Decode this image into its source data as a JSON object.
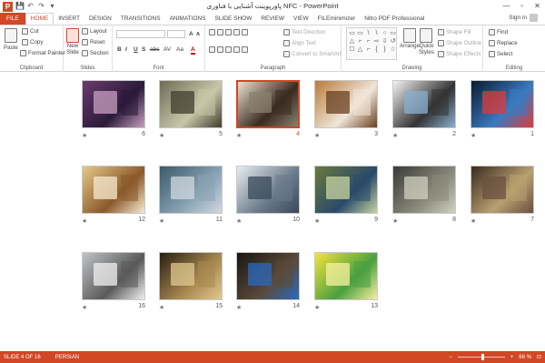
{
  "window": {
    "title": "پاورپوینت آشنایی با فناوری NFC - PowerPoint",
    "minimize": "—",
    "restore": "▫",
    "close": "✕"
  },
  "qat": {
    "app_icon": "P",
    "save": "💾",
    "undo": "↶",
    "redo": "↷",
    "customize": "▾"
  },
  "tabs": [
    "FILE",
    "HOME",
    "INSERT",
    "DESIGN",
    "TRANSITIONS",
    "ANIMATIONS",
    "SLIDE SHOW",
    "REVIEW",
    "VIEW",
    "FILEminimizer",
    "Nitro PDF Professional"
  ],
  "active_tab": "HOME",
  "signin": "Sign in",
  "ribbon": {
    "clipboard": {
      "paste": "Paste",
      "cut": "Cut",
      "copy": "Copy",
      "format_painter": "Format Painter",
      "label": "Clipboard"
    },
    "slides": {
      "new_slide": "New",
      "new_slide2": "Slide",
      "layout": "Layout",
      "reset": "Reset",
      "section": "Section",
      "label": "Slides"
    },
    "font": {
      "bold": "B",
      "italic": "I",
      "underline": "U",
      "shadow": "S",
      "strike": "abc",
      "spacing": "AV",
      "case": "Aa",
      "color": "A",
      "label": "Font"
    },
    "paragraph": {
      "text_direction": "Text Direction",
      "align_text": "Align Text",
      "convert": "Convert to SmartArt",
      "label": "Paragraph"
    },
    "drawing": {
      "arrange": "Arrange",
      "quick_styles": "Quick",
      "quick_styles2": "Styles",
      "shape_fill": "Shape Fill",
      "shape_outline": "Shape Outline",
      "shape_effects": "Shape Effects",
      "label": "Drawing",
      "shapes": [
        "▭",
        "▭",
        "\\",
        "\\",
        "○",
        "▭",
        "△",
        "⌐",
        "⌐",
        "⇨",
        "⇩",
        "↺",
        "☐",
        "△",
        "⌐",
        "{",
        "}",
        "☆"
      ]
    },
    "editing": {
      "find": "Find",
      "replace": "Replace",
      "select": "Select",
      "label": "Editing"
    }
  },
  "slides": [
    {
      "num": "6",
      "star": "★",
      "colors": [
        "#6b3a6e",
        "#2b1a3a",
        "#c8a0c0"
      ]
    },
    {
      "num": "5",
      "star": "★",
      "colors": [
        "#6f6b55",
        "#c9c6a8",
        "#403d2e"
      ]
    },
    {
      "num": "4",
      "star": "★",
      "colors": [
        "#e9e3d0",
        "#3a2b20",
        "#8a8070"
      ],
      "selected": true
    },
    {
      "num": "3",
      "star": "★",
      "colors": [
        "#b87a3a",
        "#f0e6d8",
        "#6a4020"
      ]
    },
    {
      "num": "2",
      "star": "★",
      "colors": [
        "#f4f4f4",
        "#333333",
        "#8ab0d0"
      ]
    },
    {
      "num": "1",
      "star": "★",
      "colors": [
        "#0a1a2e",
        "#3a7ac0",
        "#e03a3a"
      ]
    },
    {
      "num": "12",
      "star": "★",
      "colors": [
        "#e6c98a",
        "#8a5a2a",
        "#f7ead0"
      ]
    },
    {
      "num": "11",
      "star": "★",
      "colors": [
        "#3a5a6a",
        "#8aa4b4",
        "#d0d8e0"
      ]
    },
    {
      "num": "10",
      "star": "★",
      "colors": [
        "#e8ecf0",
        "#6a7a8a",
        "#3a4a5a"
      ]
    },
    {
      "num": "9",
      "star": "★",
      "colors": [
        "#6a7a3a",
        "#2a4a6a",
        "#c8d4a0"
      ]
    },
    {
      "num": "8",
      "star": "★",
      "colors": [
        "#3a3a3a",
        "#8a8a7a",
        "#d0d0c0"
      ]
    },
    {
      "num": "7",
      "star": "★",
      "colors": [
        "#3a2a20",
        "#b8a070",
        "#6a5040"
      ]
    },
    {
      "num": "16",
      "star": "★",
      "colors": [
        "#c0c4c8",
        "#5a5a5a",
        "#f0f0f0"
      ]
    },
    {
      "num": "15",
      "star": "★",
      "colors": [
        "#2a1e12",
        "#a88a50",
        "#e0c890"
      ]
    },
    {
      "num": "14",
      "star": "★",
      "colors": [
        "#1a1612",
        "#5a4a3a",
        "#2a6ac0"
      ]
    },
    {
      "num": "13",
      "star": "★",
      "colors": [
        "#f4e43a",
        "#4aa040",
        "#f8f0a0"
      ]
    }
  ],
  "status": {
    "slide_info": "SLIDE 4 OF 16",
    "language": "PERSIAN",
    "zoom": "66 %",
    "zoom_level": 0.66
  },
  "colors": {
    "accent": "#d24726"
  }
}
